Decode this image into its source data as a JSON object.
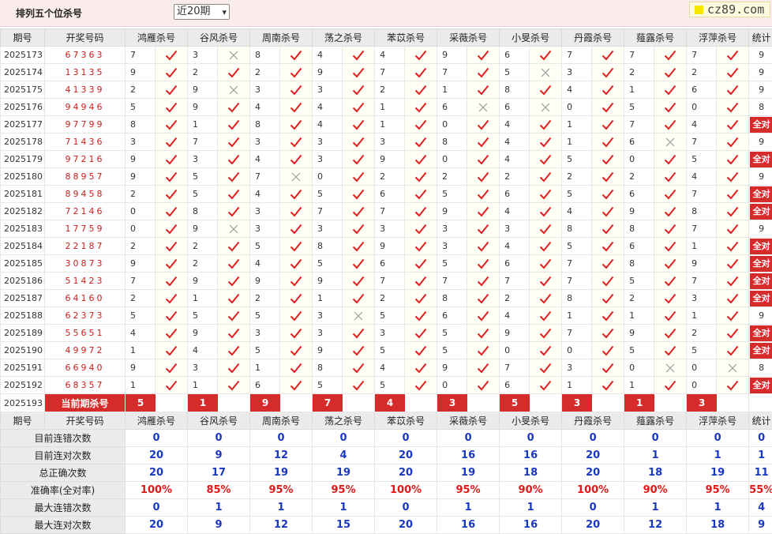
{
  "header": {
    "title": "排列五个位杀号",
    "period_select": "近20期",
    "brand": "cz89.com"
  },
  "columns": {
    "period": "期号",
    "draw": "开奖号码",
    "total": "统计",
    "experts": [
      "鸿雁杀号",
      "谷风杀号",
      "周南杀号",
      "荡之杀号",
      "苯苡杀号",
      "采薇杀号",
      "小旻杀号",
      "丹霞杀号",
      "薤露杀号",
      "浮萍杀号"
    ]
  },
  "all_correct_label": "全对",
  "rows": [
    {
      "period": "2025173",
      "draw": "67363",
      "picks": [
        [
          "7",
          1
        ],
        [
          "3",
          0
        ],
        [
          "8",
          1
        ],
        [
          "4",
          1
        ],
        [
          "4",
          1
        ],
        [
          "9",
          1
        ],
        [
          "6",
          1
        ],
        [
          "7",
          1
        ],
        [
          "7",
          1
        ],
        [
          "7",
          1
        ]
      ],
      "total": "9"
    },
    {
      "period": "2025174",
      "draw": "13135",
      "picks": [
        [
          "9",
          1
        ],
        [
          "2",
          1
        ],
        [
          "2",
          1
        ],
        [
          "9",
          1
        ],
        [
          "7",
          1
        ],
        [
          "7",
          1
        ],
        [
          "5",
          0
        ],
        [
          "3",
          1
        ],
        [
          "2",
          1
        ],
        [
          "2",
          1
        ]
      ],
      "total": "9"
    },
    {
      "period": "2025175",
      "draw": "41339",
      "picks": [
        [
          "2",
          1
        ],
        [
          "9",
          0
        ],
        [
          "3",
          1
        ],
        [
          "3",
          1
        ],
        [
          "2",
          1
        ],
        [
          "1",
          1
        ],
        [
          "8",
          1
        ],
        [
          "4",
          1
        ],
        [
          "1",
          1
        ],
        [
          "6",
          1
        ]
      ],
      "total": "9"
    },
    {
      "period": "2025176",
      "draw": "94946",
      "picks": [
        [
          "5",
          1
        ],
        [
          "9",
          1
        ],
        [
          "4",
          1
        ],
        [
          "4",
          1
        ],
        [
          "1",
          1
        ],
        [
          "6",
          0
        ],
        [
          "6",
          0
        ],
        [
          "0",
          1
        ],
        [
          "5",
          1
        ],
        [
          "0",
          1
        ]
      ],
      "total": "8"
    },
    {
      "period": "2025177",
      "draw": "97799",
      "picks": [
        [
          "8",
          1
        ],
        [
          "1",
          1
        ],
        [
          "8",
          1
        ],
        [
          "4",
          1
        ],
        [
          "1",
          1
        ],
        [
          "0",
          1
        ],
        [
          "4",
          1
        ],
        [
          "1",
          1
        ],
        [
          "7",
          1
        ],
        [
          "4",
          1
        ]
      ],
      "total": "全对"
    },
    {
      "period": "2025178",
      "draw": "71436",
      "picks": [
        [
          "3",
          1
        ],
        [
          "7",
          1
        ],
        [
          "3",
          1
        ],
        [
          "3",
          1
        ],
        [
          "3",
          1
        ],
        [
          "8",
          1
        ],
        [
          "4",
          1
        ],
        [
          "1",
          1
        ],
        [
          "6",
          0
        ],
        [
          "7",
          1
        ]
      ],
      "total": "9"
    },
    {
      "period": "2025179",
      "draw": "97216",
      "picks": [
        [
          "9",
          1
        ],
        [
          "3",
          1
        ],
        [
          "4",
          1
        ],
        [
          "3",
          1
        ],
        [
          "9",
          1
        ],
        [
          "0",
          1
        ],
        [
          "4",
          1
        ],
        [
          "5",
          1
        ],
        [
          "0",
          1
        ],
        [
          "5",
          1
        ]
      ],
      "total": "全对"
    },
    {
      "period": "2025180",
      "draw": "88957",
      "picks": [
        [
          "9",
          1
        ],
        [
          "5",
          1
        ],
        [
          "7",
          0
        ],
        [
          "0",
          1
        ],
        [
          "2",
          1
        ],
        [
          "2",
          1
        ],
        [
          "2",
          1
        ],
        [
          "2",
          1
        ],
        [
          "2",
          1
        ],
        [
          "4",
          1
        ]
      ],
      "total": "9"
    },
    {
      "period": "2025181",
      "draw": "89458",
      "picks": [
        [
          "2",
          1
        ],
        [
          "5",
          1
        ],
        [
          "4",
          1
        ],
        [
          "5",
          1
        ],
        [
          "6",
          1
        ],
        [
          "5",
          1
        ],
        [
          "6",
          1
        ],
        [
          "5",
          1
        ],
        [
          "6",
          1
        ],
        [
          "7",
          1
        ]
      ],
      "total": "全对"
    },
    {
      "period": "2025182",
      "draw": "72146",
      "picks": [
        [
          "0",
          1
        ],
        [
          "8",
          1
        ],
        [
          "3",
          1
        ],
        [
          "7",
          1
        ],
        [
          "7",
          1
        ],
        [
          "9",
          1
        ],
        [
          "4",
          1
        ],
        [
          "4",
          1
        ],
        [
          "9",
          1
        ],
        [
          "8",
          1
        ]
      ],
      "total": "全对"
    },
    {
      "period": "2025183",
      "draw": "17759",
      "picks": [
        [
          "0",
          1
        ],
        [
          "9",
          0
        ],
        [
          "3",
          1
        ],
        [
          "3",
          1
        ],
        [
          "3",
          1
        ],
        [
          "3",
          1
        ],
        [
          "3",
          1
        ],
        [
          "8",
          1
        ],
        [
          "8",
          1
        ],
        [
          "7",
          1
        ]
      ],
      "total": "9"
    },
    {
      "period": "2025184",
      "draw": "22187",
      "picks": [
        [
          "2",
          1
        ],
        [
          "2",
          1
        ],
        [
          "5",
          1
        ],
        [
          "8",
          1
        ],
        [
          "9",
          1
        ],
        [
          "3",
          1
        ],
        [
          "4",
          1
        ],
        [
          "5",
          1
        ],
        [
          "6",
          1
        ],
        [
          "1",
          1
        ]
      ],
      "total": "全对"
    },
    {
      "period": "2025185",
      "draw": "30873",
      "picks": [
        [
          "9",
          1
        ],
        [
          "2",
          1
        ],
        [
          "4",
          1
        ],
        [
          "5",
          1
        ],
        [
          "6",
          1
        ],
        [
          "5",
          1
        ],
        [
          "6",
          1
        ],
        [
          "7",
          1
        ],
        [
          "8",
          1
        ],
        [
          "9",
          1
        ]
      ],
      "total": "全对"
    },
    {
      "period": "2025186",
      "draw": "51423",
      "picks": [
        [
          "7",
          1
        ],
        [
          "9",
          1
        ],
        [
          "9",
          1
        ],
        [
          "9",
          1
        ],
        [
          "7",
          1
        ],
        [
          "7",
          1
        ],
        [
          "7",
          1
        ],
        [
          "7",
          1
        ],
        [
          "5",
          1
        ],
        [
          "7",
          1
        ]
      ],
      "total": "全对"
    },
    {
      "period": "2025187",
      "draw": "64160",
      "picks": [
        [
          "2",
          1
        ],
        [
          "1",
          1
        ],
        [
          "2",
          1
        ],
        [
          "1",
          1
        ],
        [
          "2",
          1
        ],
        [
          "8",
          1
        ],
        [
          "2",
          1
        ],
        [
          "8",
          1
        ],
        [
          "2",
          1
        ],
        [
          "3",
          1
        ]
      ],
      "total": "全对"
    },
    {
      "period": "2025188",
      "draw": "62373",
      "picks": [
        [
          "5",
          1
        ],
        [
          "5",
          1
        ],
        [
          "5",
          1
        ],
        [
          "3",
          0
        ],
        [
          "5",
          1
        ],
        [
          "6",
          1
        ],
        [
          "4",
          1
        ],
        [
          "1",
          1
        ],
        [
          "1",
          1
        ],
        [
          "1",
          1
        ]
      ],
      "total": "9"
    },
    {
      "period": "2025189",
      "draw": "55651",
      "picks": [
        [
          "4",
          1
        ],
        [
          "9",
          1
        ],
        [
          "3",
          1
        ],
        [
          "3",
          1
        ],
        [
          "3",
          1
        ],
        [
          "5",
          1
        ],
        [
          "9",
          1
        ],
        [
          "7",
          1
        ],
        [
          "9",
          1
        ],
        [
          "2",
          1
        ]
      ],
      "total": "全对"
    },
    {
      "period": "2025190",
      "draw": "49972",
      "picks": [
        [
          "1",
          1
        ],
        [
          "4",
          1
        ],
        [
          "5",
          1
        ],
        [
          "9",
          1
        ],
        [
          "5",
          1
        ],
        [
          "5",
          1
        ],
        [
          "0",
          1
        ],
        [
          "0",
          1
        ],
        [
          "5",
          1
        ],
        [
          "5",
          1
        ]
      ],
      "total": "全对"
    },
    {
      "period": "2025191",
      "draw": "66940",
      "picks": [
        [
          "9",
          1
        ],
        [
          "3",
          1
        ],
        [
          "1",
          1
        ],
        [
          "8",
          1
        ],
        [
          "4",
          1
        ],
        [
          "9",
          1
        ],
        [
          "7",
          1
        ],
        [
          "3",
          1
        ],
        [
          "0",
          0
        ],
        [
          "0",
          0
        ]
      ],
      "total": "8"
    },
    {
      "period": "2025192",
      "draw": "68357",
      "picks": [
        [
          "1",
          1
        ],
        [
          "1",
          1
        ],
        [
          "6",
          1
        ],
        [
          "5",
          1
        ],
        [
          "5",
          1
        ],
        [
          "0",
          1
        ],
        [
          "6",
          1
        ],
        [
          "1",
          1
        ],
        [
          "1",
          1
        ],
        [
          "0",
          1
        ]
      ],
      "total": "全对"
    }
  ],
  "current": {
    "period": "2025193",
    "label": "当前期杀号",
    "picks": [
      "5",
      "1",
      "9",
      "7",
      "4",
      "3",
      "5",
      "3",
      "1",
      "3"
    ]
  },
  "stats": [
    {
      "label": "目前连错次数",
      "values": [
        "0",
        "0",
        "0",
        "0",
        "0",
        "0",
        "0",
        "0",
        "0",
        "0",
        "0"
      ]
    },
    {
      "label": "目前连对次数",
      "values": [
        "20",
        "9",
        "12",
        "4",
        "20",
        "16",
        "16",
        "20",
        "1",
        "1",
        "1"
      ]
    },
    {
      "label": "总正确次数",
      "values": [
        "20",
        "17",
        "19",
        "19",
        "20",
        "19",
        "18",
        "20",
        "18",
        "19",
        "11"
      ]
    },
    {
      "label": "准确率(全对率)",
      "values": [
        "100%",
        "85%",
        "95%",
        "95%",
        "100%",
        "95%",
        "90%",
        "100%",
        "90%",
        "95%",
        "55%"
      ],
      "rate": true
    },
    {
      "label": "最大连错次数",
      "values": [
        "0",
        "1",
        "1",
        "1",
        "0",
        "1",
        "1",
        "0",
        "1",
        "1",
        "4"
      ]
    },
    {
      "label": "最大连对次数",
      "values": [
        "20",
        "9",
        "12",
        "15",
        "20",
        "16",
        "16",
        "20",
        "12",
        "18",
        "9"
      ]
    }
  ],
  "colors": {
    "accent_red": "#d62b2b",
    "header_pink": "#fbecec",
    "stat_blue": "#1a38c0",
    "check_red": "#e02020",
    "cross_gray": "#9a9a9a"
  }
}
